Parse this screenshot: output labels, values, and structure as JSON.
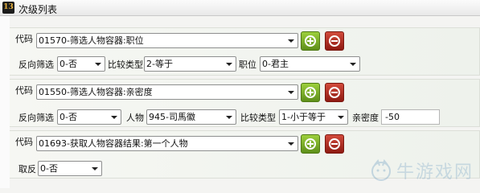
{
  "window": {
    "title": "次级列表",
    "app_icon_text": "13"
  },
  "rows": [
    {
      "code_label": "代码",
      "code_value": "01570-筛选人物容器:职位",
      "fields": [
        {
          "label": "反向筛选",
          "value": "0-否"
        },
        {
          "label": "比较类型",
          "value": "2-等于"
        },
        {
          "label": "职位",
          "value": "0-君主"
        }
      ]
    },
    {
      "code_label": "代码",
      "code_value": "01550-筛选人物容器:亲密度",
      "fields": [
        {
          "label": "反向筛选",
          "value": "0-否"
        },
        {
          "label": "人物",
          "value": "945-司馬徽"
        },
        {
          "label": "比较类型",
          "value": "1-小于等于"
        }
      ],
      "text_field": {
        "label": "亲密度",
        "value": "-50"
      }
    },
    {
      "code_label": "代码",
      "code_value": "01693-获取人物容器结果:第一个人物",
      "fields": [
        {
          "label": "取反",
          "value": "0-否"
        }
      ]
    }
  ],
  "icons": {
    "add": "add-icon",
    "remove": "remove-icon"
  },
  "watermark": {
    "text": "牛游戏网"
  },
  "colors": {
    "add_button": "#6fa023",
    "remove_button": "#a8261a"
  }
}
